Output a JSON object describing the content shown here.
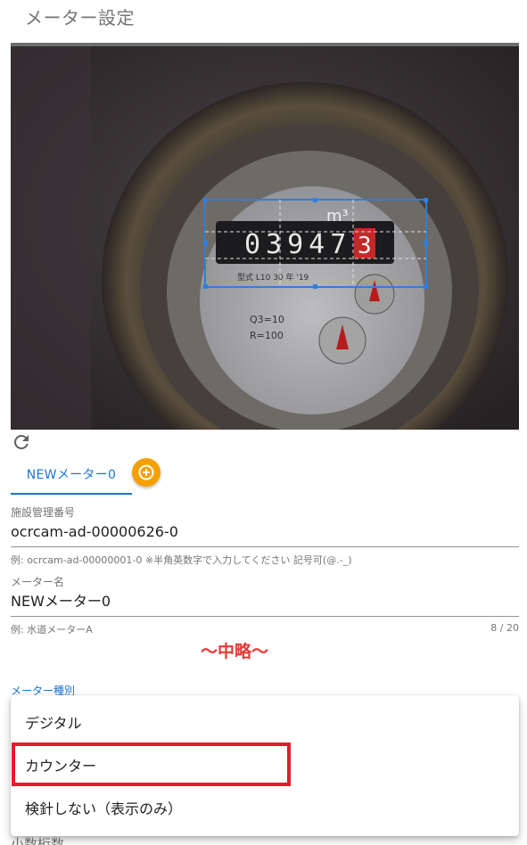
{
  "page": {
    "title": "メーター設定"
  },
  "camera": {
    "meter_reading": "03947",
    "meter_last_digit": "3",
    "meter_unit": "m³",
    "meter_plate": "型式 L10 30 年 '19",
    "q_label": "Q3=10",
    "r_label": "R=100"
  },
  "tabs": [
    {
      "label": "NEWメーター0",
      "selected": true
    }
  ],
  "form": {
    "facility_number": {
      "label": "施設管理番号",
      "value": "ocrcam-ad-00000626-0",
      "hint": "例: ocrcam-ad-00000001-0 ※半角英数字で入力してください 記号可(@.-_)"
    },
    "meter_name": {
      "label": "メーター名",
      "value": "NEWメーター0",
      "hint": "例: 水道メーターA",
      "counter": "8 / 20"
    }
  },
  "omitted_note": "〜中略〜",
  "meter_type": {
    "label": "メーター種別",
    "options": [
      "デジタル",
      "カウンター",
      "検針しない（表示のみ）"
    ],
    "highlighted_index": 1
  },
  "next_label": "小数桁数",
  "colors": {
    "accent": "#1976d2",
    "fab": "#f5a000",
    "highlight": "#e8192c"
  }
}
